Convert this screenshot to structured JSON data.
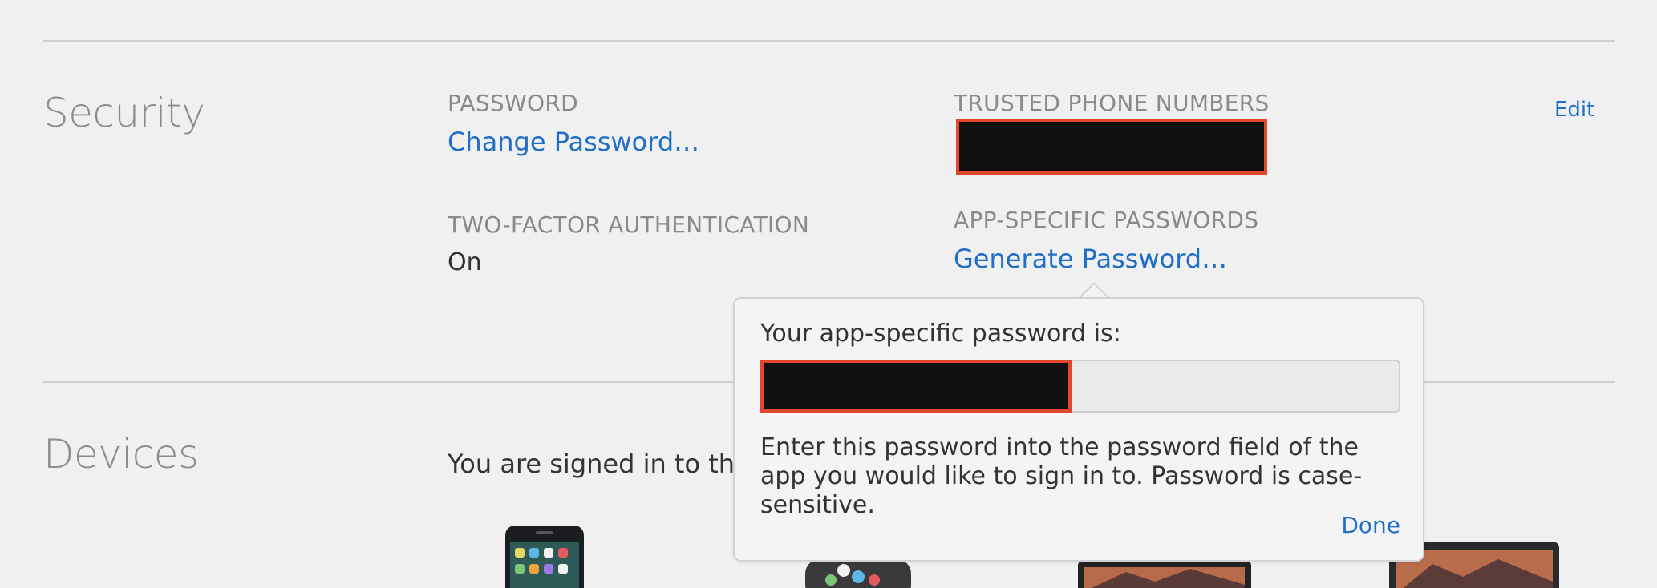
{
  "security": {
    "title": "Security",
    "edit_label": "Edit",
    "password": {
      "label": "PASSWORD",
      "link": "Change Password…"
    },
    "two_factor": {
      "label": "TWO-FACTOR AUTHENTICATION",
      "value": "On"
    },
    "trusted_phones": {
      "label": "TRUSTED PHONE NUMBERS"
    },
    "app_specific": {
      "label": "APP-SPECIFIC PASSWORDS",
      "link": "Generate Password…"
    }
  },
  "popover": {
    "heading": "Your app-specific password is:",
    "description": "Enter this password into the password field of the app you would like to sign in to. Password is case-sensitive.",
    "done_label": "Done"
  },
  "devices": {
    "title": "Devices",
    "signed_in_text": "You are signed in to the"
  },
  "colors": {
    "link": "#1f6fc6",
    "redaction": "#111111",
    "redaction_border": "#e0472c",
    "background": "#f0f0f1"
  },
  "icons": [
    "iphone-icon",
    "apple-watch-icon",
    "ipad-icon",
    "macbook-icon"
  ]
}
